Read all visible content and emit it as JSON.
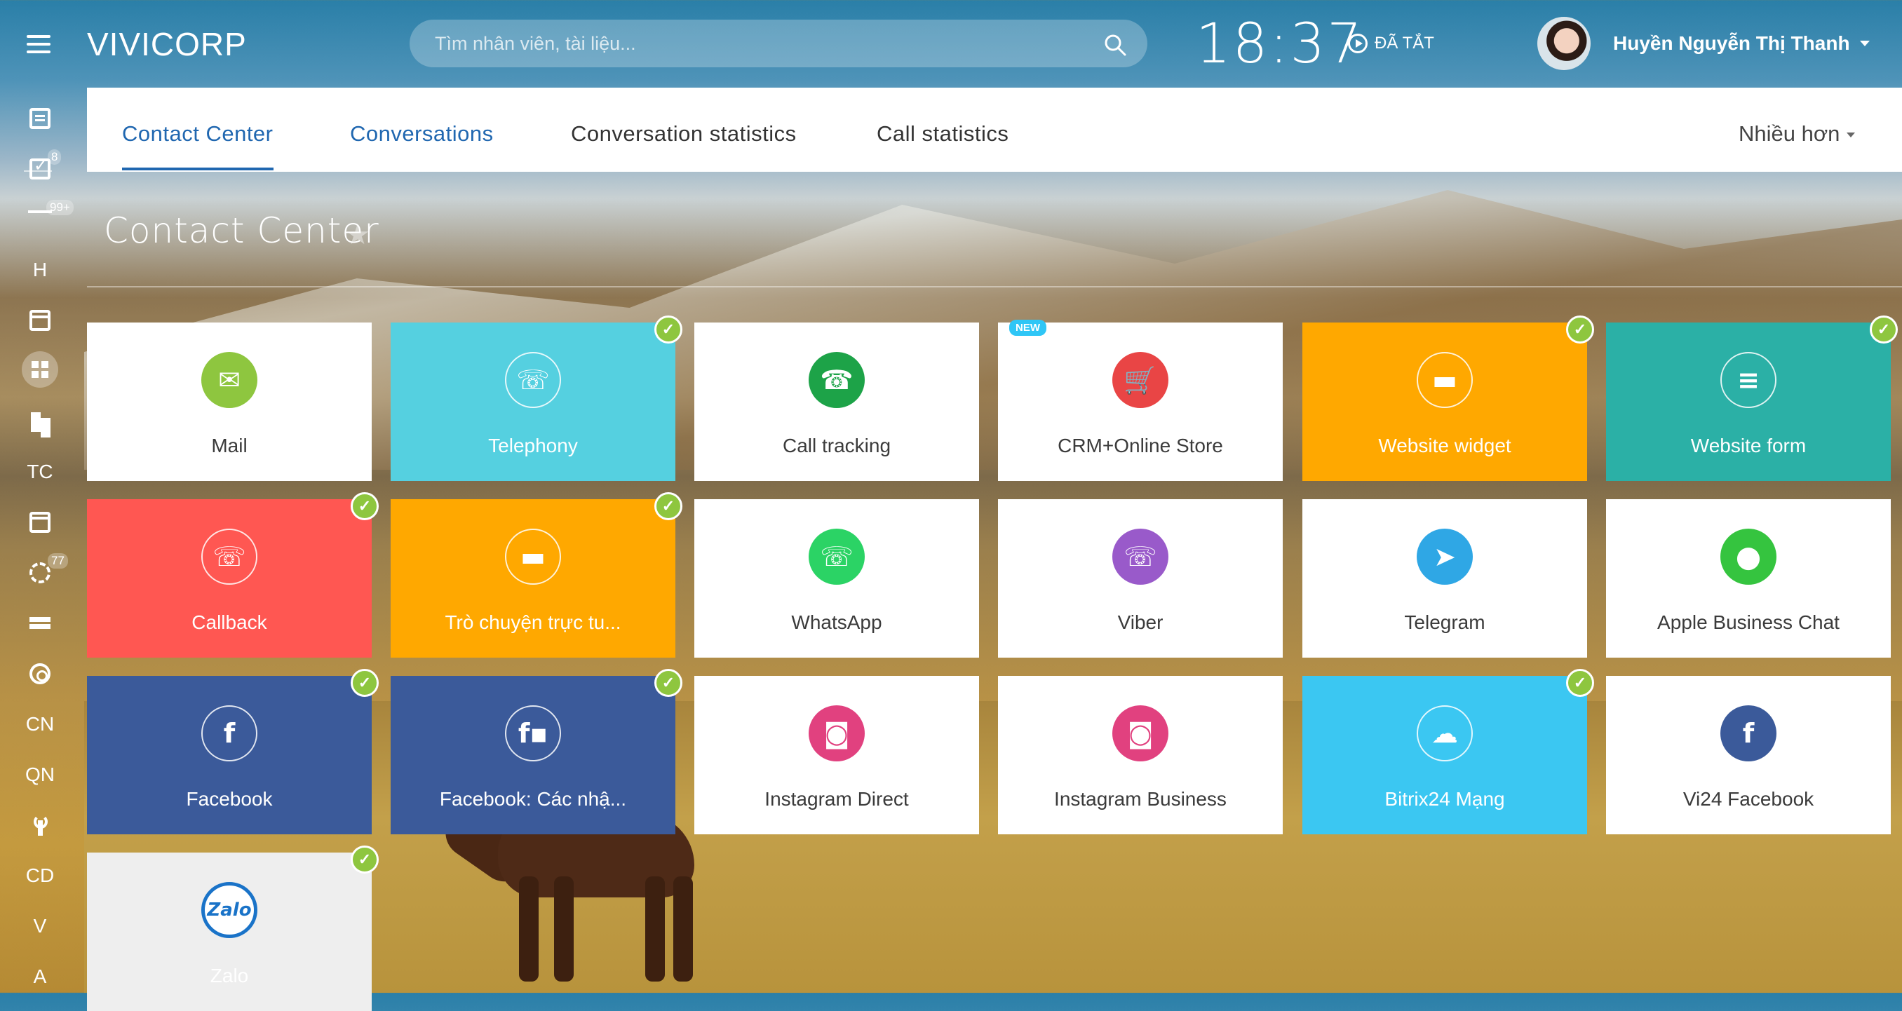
{
  "header": {
    "logo": "VIVICORP",
    "search_placeholder": "Tìm nhân viên, tài liệu...",
    "time": "18:37",
    "status": "ĐÃ TẮT",
    "user_name": "Huyền Nguyễn Thị Thanh"
  },
  "sidebar": {
    "badges": {
      "tasks": "8",
      "feed": "99+",
      "sync": "77"
    },
    "letters": {
      "h": "H",
      "tc": "TC",
      "cn": "CN",
      "qn": "QN",
      "cd": "CD",
      "v": "V",
      "a": "A"
    }
  },
  "tabs": {
    "contact_center": "Contact Center",
    "conversations": "Conversations",
    "conversation_statistics": "Conversation statistics",
    "call_statistics": "Call statistics",
    "more": "Nhiều hơn"
  },
  "page": {
    "title": "Contact Center"
  },
  "tiles": [
    {
      "label": "Mail",
      "icon": "mail-icon",
      "bg": "#ffffff",
      "icon_bg": "#8ec63f",
      "connected": false
    },
    {
      "label": "Telephony",
      "icon": "phone-icon",
      "bg": "#55d0e0",
      "icon_bg": "transparent",
      "connected": true
    },
    {
      "label": "Call tracking",
      "icon": "call-tracking-icon",
      "bg": "#ffffff",
      "icon_bg": "#1da348",
      "connected": false
    },
    {
      "label": "CRM+Online Store",
      "icon": "cart-icon",
      "bg": "#ffffff",
      "icon_bg": "#e94545",
      "connected": false,
      "badge": "NEW"
    },
    {
      "label": "Website widget",
      "icon": "chat-icon",
      "bg": "#ffa800",
      "icon_bg": "transparent",
      "connected": true
    },
    {
      "label": "Website form",
      "icon": "form-icon",
      "bg": "#2bb0a6",
      "icon_bg": "transparent",
      "connected": true
    },
    {
      "label": "Callback",
      "icon": "phone-icon",
      "bg": "#ff5752",
      "icon_bg": "transparent",
      "connected": true
    },
    {
      "label": "Trò chuyện trực tu...",
      "icon": "chat-icon",
      "bg": "#ffa800",
      "icon_bg": "transparent",
      "connected": true
    },
    {
      "label": "WhatsApp",
      "icon": "whatsapp-icon",
      "bg": "#ffffff",
      "icon_bg": "#2bd365",
      "connected": false
    },
    {
      "label": "Viber",
      "icon": "viber-icon",
      "bg": "#ffffff",
      "icon_bg": "#995aca",
      "connected": false
    },
    {
      "label": "Telegram",
      "icon": "telegram-icon",
      "bg": "#ffffff",
      "icon_bg": "#2fa7e5",
      "connected": false
    },
    {
      "label": "Apple Business Chat",
      "icon": "speech-bubble-icon",
      "bg": "#ffffff",
      "icon_bg": "#35c43f",
      "connected": false
    },
    {
      "label": "Facebook",
      "icon": "facebook-icon",
      "bg": "#3b5a9a",
      "icon_bg": "transparent",
      "connected": true
    },
    {
      "label": "Facebook: Các nhậ...",
      "icon": "facebook-comments-icon",
      "bg": "#3b5a9a",
      "icon_bg": "transparent",
      "connected": true
    },
    {
      "label": "Instagram Direct",
      "icon": "instagram-direct-icon",
      "bg": "#ffffff",
      "icon_bg": "#e1417f",
      "connected": false
    },
    {
      "label": "Instagram Business",
      "icon": "instagram-business-icon",
      "bg": "#ffffff",
      "icon_bg": "#e1417f",
      "connected": false
    },
    {
      "label": "Bitrix24 Mạng",
      "icon": "cloud-icon",
      "bg": "#3bc7f2",
      "icon_bg": "transparent",
      "connected": true
    },
    {
      "label": "Vi24 Facebook",
      "icon": "facebook-icon",
      "bg": "#ffffff",
      "icon_bg": "#3b5a9a",
      "connected": false
    },
    {
      "label": "Zalo",
      "icon": "zalo-icon",
      "bg": "#eeeeee",
      "icon_bg": "#ffffff",
      "connected": true
    }
  ]
}
